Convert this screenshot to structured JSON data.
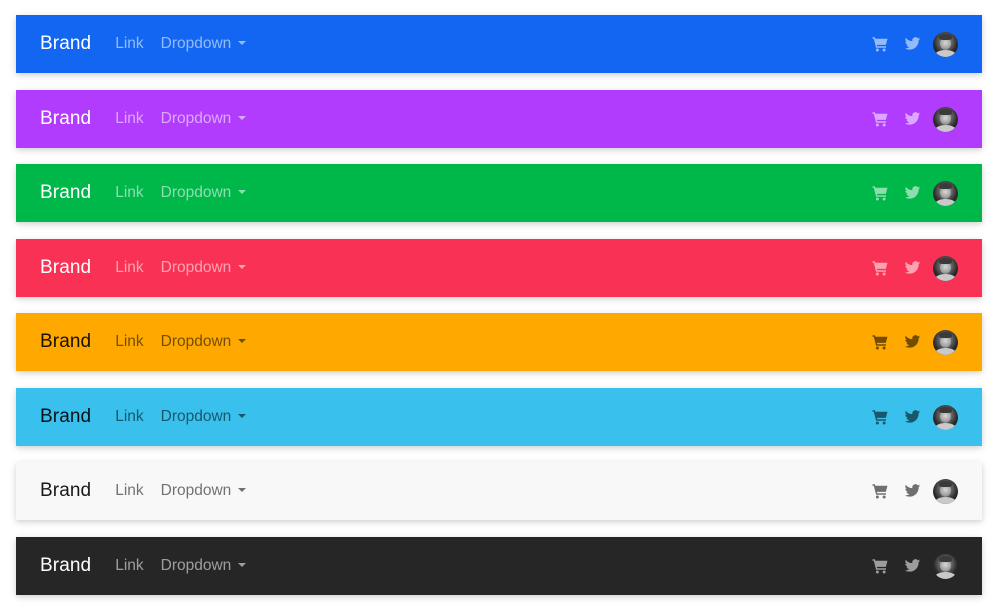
{
  "navbars": [
    {
      "variant": "primary",
      "bg": "#1266f1",
      "brand_color": "#ffffff",
      "link_color": "rgba(255,255,255,0.55)",
      "icon_color": "rgba(255,255,255,0.55)",
      "brand": "Brand",
      "link": "Link",
      "dropdown": "Dropdown",
      "icons": [
        "cart-icon",
        "twitter-icon"
      ],
      "avatar": "user-avatar"
    },
    {
      "variant": "secondary",
      "bg": "#b23cfd",
      "brand_color": "#ffffff",
      "link_color": "rgba(255,255,255,0.55)",
      "icon_color": "rgba(255,255,255,0.55)",
      "brand": "Brand",
      "link": "Link",
      "dropdown": "Dropdown",
      "icons": [
        "cart-icon",
        "twitter-icon"
      ],
      "avatar": "user-avatar"
    },
    {
      "variant": "success",
      "bg": "#00b74a",
      "brand_color": "#ffffff",
      "link_color": "rgba(255,255,255,0.55)",
      "icon_color": "rgba(255,255,255,0.55)",
      "brand": "Brand",
      "link": "Link",
      "dropdown": "Dropdown",
      "icons": [
        "cart-icon",
        "twitter-icon"
      ],
      "avatar": "user-avatar"
    },
    {
      "variant": "danger",
      "bg": "#f93154",
      "brand_color": "#ffffff",
      "link_color": "rgba(255,255,255,0.55)",
      "icon_color": "rgba(255,255,255,0.55)",
      "brand": "Brand",
      "link": "Link",
      "dropdown": "Dropdown",
      "icons": [
        "cart-icon",
        "twitter-icon"
      ],
      "avatar": "user-avatar"
    },
    {
      "variant": "warning",
      "bg": "#ffa900",
      "brand_color": "rgba(0,0,0,0.9)",
      "link_color": "rgba(0,0,0,0.55)",
      "icon_color": "rgba(0,0,0,0.55)",
      "brand": "Brand",
      "link": "Link",
      "dropdown": "Dropdown",
      "icons": [
        "cart-icon",
        "twitter-icon"
      ],
      "avatar": "user-avatar"
    },
    {
      "variant": "info",
      "bg": "#39c0ed",
      "brand_color": "rgba(0,0,0,0.9)",
      "link_color": "rgba(0,0,0,0.55)",
      "icon_color": "rgba(0,0,0,0.55)",
      "brand": "Brand",
      "link": "Link",
      "dropdown": "Dropdown",
      "icons": [
        "cart-icon",
        "twitter-icon"
      ],
      "avatar": "user-avatar"
    },
    {
      "variant": "light",
      "bg": "#f8f8f8",
      "brand_color": "rgba(0,0,0,0.9)",
      "link_color": "rgba(0,0,0,0.55)",
      "icon_color": "rgba(0,0,0,0.55)",
      "brand": "Brand",
      "link": "Link",
      "dropdown": "Dropdown",
      "icons": [
        "cart-icon",
        "twitter-icon"
      ],
      "avatar": "user-avatar"
    },
    {
      "variant": "dark",
      "bg": "#262626",
      "brand_color": "#ffffff",
      "link_color": "rgba(255,255,255,0.55)",
      "icon_color": "rgba(255,255,255,0.55)",
      "brand": "Brand",
      "link": "Link",
      "dropdown": "Dropdown",
      "icons": [
        "cart-icon",
        "twitter-icon"
      ],
      "avatar": "user-avatar"
    }
  ]
}
